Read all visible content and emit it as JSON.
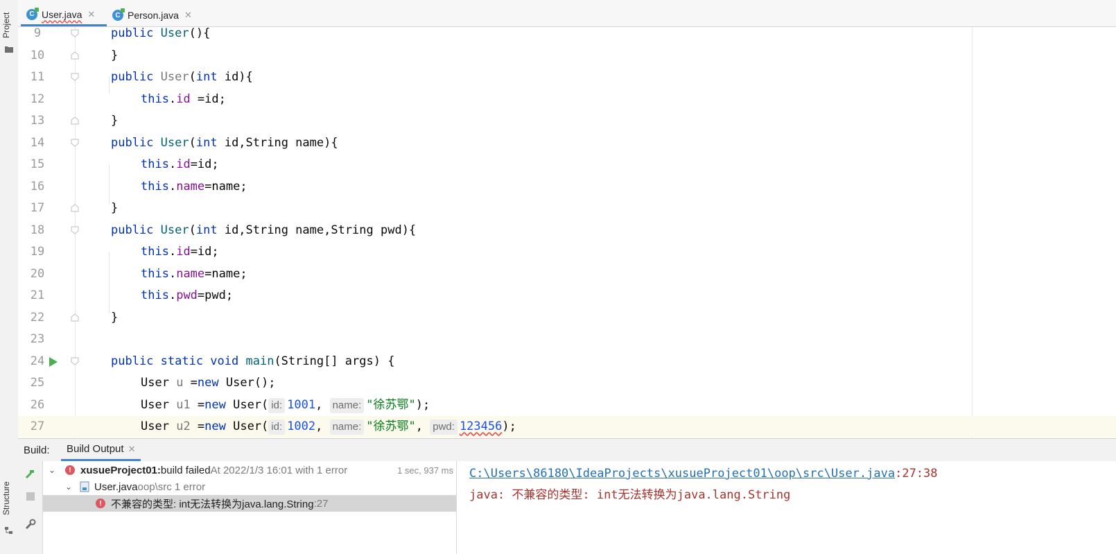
{
  "left_strip": {
    "project_label": "Project",
    "structure_label": "Structure"
  },
  "tabs": [
    {
      "label": "User.java",
      "icon": "class-icon",
      "active": true
    },
    {
      "label": "Person.java",
      "icon": "class-icon",
      "active": false
    }
  ],
  "editor": {
    "line_numbers": [
      "9",
      "10",
      "11",
      "12",
      "13",
      "14",
      "15",
      "16",
      "17",
      "18",
      "19",
      "20",
      "21",
      "22",
      "23",
      "24",
      "25",
      "26",
      "27"
    ],
    "l9": {
      "kw": "public",
      "name": "User",
      "rest": "(){"
    },
    "l10": "}",
    "l11": {
      "kw": "public",
      "name": "User",
      "open": "(",
      "type": "int",
      "rest": " id){"
    },
    "l12": {
      "this": "this",
      "field": "id",
      "rest": " =id;"
    },
    "l13": "}",
    "l14": {
      "kw": "public",
      "name": "User",
      "open": "(",
      "type": "int",
      "rest": " id,String name){"
    },
    "l15": {
      "this": "this",
      "field": "id",
      "rest": "=id;"
    },
    "l16": {
      "this": "this",
      "field": "name",
      "rest": "=name;"
    },
    "l17": "}",
    "l18": {
      "kw": "public",
      "name": "User",
      "open": "(",
      "type": "int",
      "rest": " id,String name,String pwd){"
    },
    "l19": {
      "this": "this",
      "field": "id",
      "rest": "=id;"
    },
    "l20": {
      "this": "this",
      "field": "name",
      "rest": "=name;"
    },
    "l21": {
      "this": "this",
      "field": "pwd",
      "rest": "=pwd;"
    },
    "l22": "}",
    "l24": {
      "mods": "public static void",
      "name": "main",
      "rest": "(String[] args) {"
    },
    "l25": {
      "a": "User ",
      "var": "u",
      "b": " =",
      "kw": "new",
      "c": " User();"
    },
    "l26": {
      "a": "User ",
      "var": "u1",
      "b": " =",
      "kw": "new",
      "c": " User(",
      "hint_id": "id:",
      "v1": "1001",
      "comma1": ", ",
      "hint_name": "name:",
      "v2": "\"徐苏鄂\"",
      "end": ");"
    },
    "l27": {
      "a": "User ",
      "var": "u2",
      "b": " =",
      "kw": "new",
      "c": " User(",
      "hint_id": "id:",
      "v1": "1002",
      "comma1": ", ",
      "hint_name": "name:",
      "v2": "\"徐苏鄂\"",
      "comma2": ", ",
      "hint_pwd": "pwd:",
      "v3": "123456",
      "end": ");"
    }
  },
  "build": {
    "label": "Build:",
    "tab": "Build Output",
    "tree": {
      "project": "xusueProject01:",
      "status": " build failed",
      "at": " At 2022/1/3 16:01 with 1 error",
      "time": "1 sec, 937 ms",
      "file": "User.java",
      "path": " oop\\src 1 error",
      "error": "不兼容的类型: int无法转换为java.lang.String",
      "error_line": " :27"
    },
    "console": {
      "link": "C:\\Users\\86180\\IdeaProjects\\xusueProject01\\oop\\src\\User.java",
      "pos": ":27:38",
      "msg_prefix": "java: ",
      "msg_cjk": "不兼容的类型",
      "msg_colon": ": int",
      "msg_cjk2": "无法转换为",
      "msg_end": "java.lang.String"
    }
  },
  "colors": {
    "keyword": "#0033b3",
    "field": "#871094",
    "string": "#067d17",
    "number": "#1750eb",
    "error": "#db5860",
    "accent": "#4083c9"
  }
}
